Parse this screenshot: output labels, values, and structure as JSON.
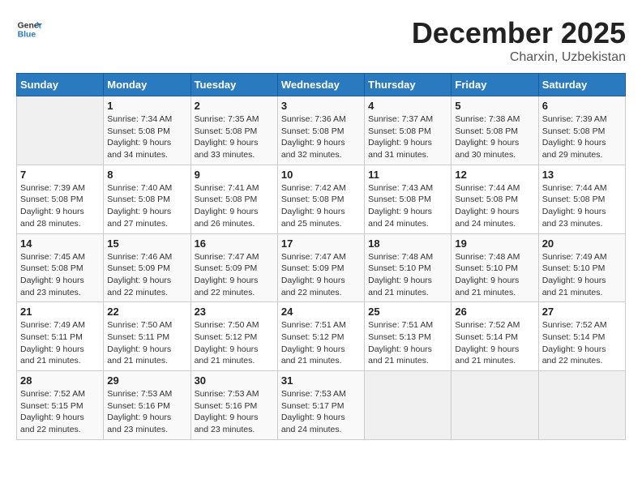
{
  "header": {
    "logo_line1": "General",
    "logo_line2": "Blue",
    "month": "December 2025",
    "location": "Charxin, Uzbekistan"
  },
  "weekdays": [
    "Sunday",
    "Monday",
    "Tuesday",
    "Wednesday",
    "Thursday",
    "Friday",
    "Saturday"
  ],
  "weeks": [
    [
      {
        "day": "",
        "info": ""
      },
      {
        "day": "1",
        "info": "Sunrise: 7:34 AM\nSunset: 5:08 PM\nDaylight: 9 hours\nand 34 minutes."
      },
      {
        "day": "2",
        "info": "Sunrise: 7:35 AM\nSunset: 5:08 PM\nDaylight: 9 hours\nand 33 minutes."
      },
      {
        "day": "3",
        "info": "Sunrise: 7:36 AM\nSunset: 5:08 PM\nDaylight: 9 hours\nand 32 minutes."
      },
      {
        "day": "4",
        "info": "Sunrise: 7:37 AM\nSunset: 5:08 PM\nDaylight: 9 hours\nand 31 minutes."
      },
      {
        "day": "5",
        "info": "Sunrise: 7:38 AM\nSunset: 5:08 PM\nDaylight: 9 hours\nand 30 minutes."
      },
      {
        "day": "6",
        "info": "Sunrise: 7:39 AM\nSunset: 5:08 PM\nDaylight: 9 hours\nand 29 minutes."
      }
    ],
    [
      {
        "day": "7",
        "info": "Sunrise: 7:39 AM\nSunset: 5:08 PM\nDaylight: 9 hours\nand 28 minutes."
      },
      {
        "day": "8",
        "info": "Sunrise: 7:40 AM\nSunset: 5:08 PM\nDaylight: 9 hours\nand 27 minutes."
      },
      {
        "day": "9",
        "info": "Sunrise: 7:41 AM\nSunset: 5:08 PM\nDaylight: 9 hours\nand 26 minutes."
      },
      {
        "day": "10",
        "info": "Sunrise: 7:42 AM\nSunset: 5:08 PM\nDaylight: 9 hours\nand 25 minutes."
      },
      {
        "day": "11",
        "info": "Sunrise: 7:43 AM\nSunset: 5:08 PM\nDaylight: 9 hours\nand 24 minutes."
      },
      {
        "day": "12",
        "info": "Sunrise: 7:44 AM\nSunset: 5:08 PM\nDaylight: 9 hours\nand 24 minutes."
      },
      {
        "day": "13",
        "info": "Sunrise: 7:44 AM\nSunset: 5:08 PM\nDaylight: 9 hours\nand 23 minutes."
      }
    ],
    [
      {
        "day": "14",
        "info": "Sunrise: 7:45 AM\nSunset: 5:08 PM\nDaylight: 9 hours\nand 23 minutes."
      },
      {
        "day": "15",
        "info": "Sunrise: 7:46 AM\nSunset: 5:09 PM\nDaylight: 9 hours\nand 22 minutes."
      },
      {
        "day": "16",
        "info": "Sunrise: 7:47 AM\nSunset: 5:09 PM\nDaylight: 9 hours\nand 22 minutes."
      },
      {
        "day": "17",
        "info": "Sunrise: 7:47 AM\nSunset: 5:09 PM\nDaylight: 9 hours\nand 22 minutes."
      },
      {
        "day": "18",
        "info": "Sunrise: 7:48 AM\nSunset: 5:10 PM\nDaylight: 9 hours\nand 21 minutes."
      },
      {
        "day": "19",
        "info": "Sunrise: 7:48 AM\nSunset: 5:10 PM\nDaylight: 9 hours\nand 21 minutes."
      },
      {
        "day": "20",
        "info": "Sunrise: 7:49 AM\nSunset: 5:10 PM\nDaylight: 9 hours\nand 21 minutes."
      }
    ],
    [
      {
        "day": "21",
        "info": "Sunrise: 7:49 AM\nSunset: 5:11 PM\nDaylight: 9 hours\nand 21 minutes."
      },
      {
        "day": "22",
        "info": "Sunrise: 7:50 AM\nSunset: 5:11 PM\nDaylight: 9 hours\nand 21 minutes."
      },
      {
        "day": "23",
        "info": "Sunrise: 7:50 AM\nSunset: 5:12 PM\nDaylight: 9 hours\nand 21 minutes."
      },
      {
        "day": "24",
        "info": "Sunrise: 7:51 AM\nSunset: 5:12 PM\nDaylight: 9 hours\nand 21 minutes."
      },
      {
        "day": "25",
        "info": "Sunrise: 7:51 AM\nSunset: 5:13 PM\nDaylight: 9 hours\nand 21 minutes."
      },
      {
        "day": "26",
        "info": "Sunrise: 7:52 AM\nSunset: 5:14 PM\nDaylight: 9 hours\nand 21 minutes."
      },
      {
        "day": "27",
        "info": "Sunrise: 7:52 AM\nSunset: 5:14 PM\nDaylight: 9 hours\nand 22 minutes."
      }
    ],
    [
      {
        "day": "28",
        "info": "Sunrise: 7:52 AM\nSunset: 5:15 PM\nDaylight: 9 hours\nand 22 minutes."
      },
      {
        "day": "29",
        "info": "Sunrise: 7:53 AM\nSunset: 5:16 PM\nDaylight: 9 hours\nand 23 minutes."
      },
      {
        "day": "30",
        "info": "Sunrise: 7:53 AM\nSunset: 5:16 PM\nDaylight: 9 hours\nand 23 minutes."
      },
      {
        "day": "31",
        "info": "Sunrise: 7:53 AM\nSunset: 5:17 PM\nDaylight: 9 hours\nand 24 minutes."
      },
      {
        "day": "",
        "info": ""
      },
      {
        "day": "",
        "info": ""
      },
      {
        "day": "",
        "info": ""
      }
    ]
  ]
}
